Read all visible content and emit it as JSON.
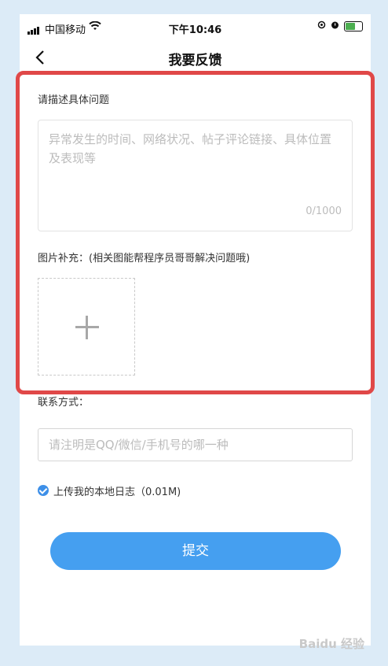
{
  "status_bar": {
    "carrier": "中国移动",
    "time": "下午10:46"
  },
  "navbar": {
    "back_icon": "chevron-left-icon",
    "title": "我要反馈"
  },
  "description": {
    "label": "请描述具体问题",
    "placeholder": "异常发生的时间、网络状况、帖子评论链接、具体位置及表现等",
    "counter": "0/1000"
  },
  "images": {
    "label": "图片补充：(相关图能帮程序员哥哥解决问题哦)",
    "add_icon": "plus-icon"
  },
  "contact": {
    "label": "联系方式：",
    "placeholder": "请注明是QQ/微信/手机号的哪一种"
  },
  "upload_log": {
    "label": "上传我的本地日志（0.01M)",
    "checked": true
  },
  "submit": {
    "label": "提交"
  },
  "colors": {
    "accent": "#459ff0",
    "highlight": "#e04848",
    "background": "#dcebf7"
  },
  "watermark": "Baidu 经验"
}
